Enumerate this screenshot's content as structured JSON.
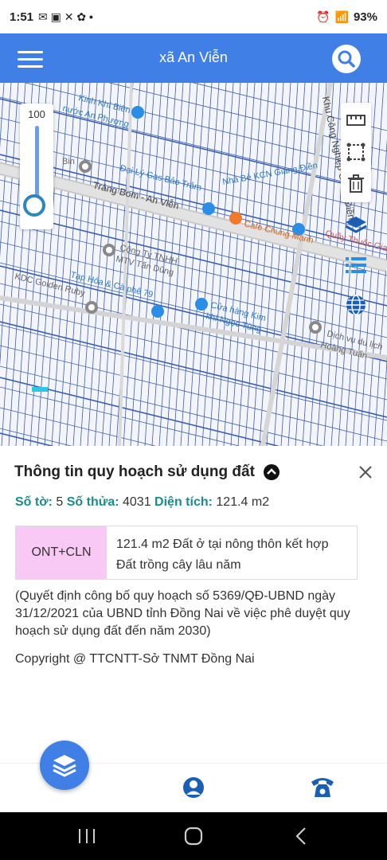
{
  "status_bar": {
    "time": "1:51",
    "battery": "93%"
  },
  "app_bar": {
    "title": "xã An Viễn"
  },
  "slider": {
    "value": "100",
    "level_percent": 100
  },
  "map_labels": {
    "road_main": "Trảng Bom - An Viễn",
    "kcn": "Khu Công Nghiệp Giang Điền",
    "place1": "Kinh Khí Biên",
    "place1b": "nước An Phương",
    "place2": "Đại Lý Gas Bảo Trâm",
    "place3": "Nhà Bè KCN Giang Điền",
    "place4": "Cafe Chung Mạnh",
    "place5": "Quầy Thuốc Gia",
    "place6": "Công Ty TNHH",
    "place6b": "MTV Tấn Dũng",
    "place7": "Tạp Hóa & Cà phê 79",
    "place8": "KDC Golden Ruby",
    "place9": "Cửa hàng Kim",
    "place9b": "khí Ngọc Tùng",
    "place10": "Dịch vụ du lịch",
    "place10b": "Hoàng Tuấn",
    "place11": "Bin"
  },
  "info_sheet": {
    "title": "Thông tin quy hoạch sử dụng đất",
    "so_to_label": "Số tờ:",
    "so_to_value": "5",
    "so_thua_label": "Số thửa:",
    "so_thua_value": "4031",
    "dien_tich_label": "Diện tích:",
    "dien_tich_value": "121.4 m2",
    "plan_code": "ONT+CLN",
    "plan_desc": "121.4 m2 Đất ở tại nông thôn kết hợp Đất trồng cây lâu năm",
    "decision": "(Quyết định công bố quy hoạch số 5369/QĐ-UBND ngày 31/12/2021 của UBND tỉnh Đồng Nai về việc phê duyệt quy hoạch sử dụng đất đến năm 2030)",
    "copyright": "Copyright @ TTCNTT-Sở TNMT Đồng Nai"
  },
  "colors": {
    "accent": "#3f7fe6",
    "plan_code_bg": "#f8c9f4",
    "label_teal": "#1a8c8c"
  }
}
